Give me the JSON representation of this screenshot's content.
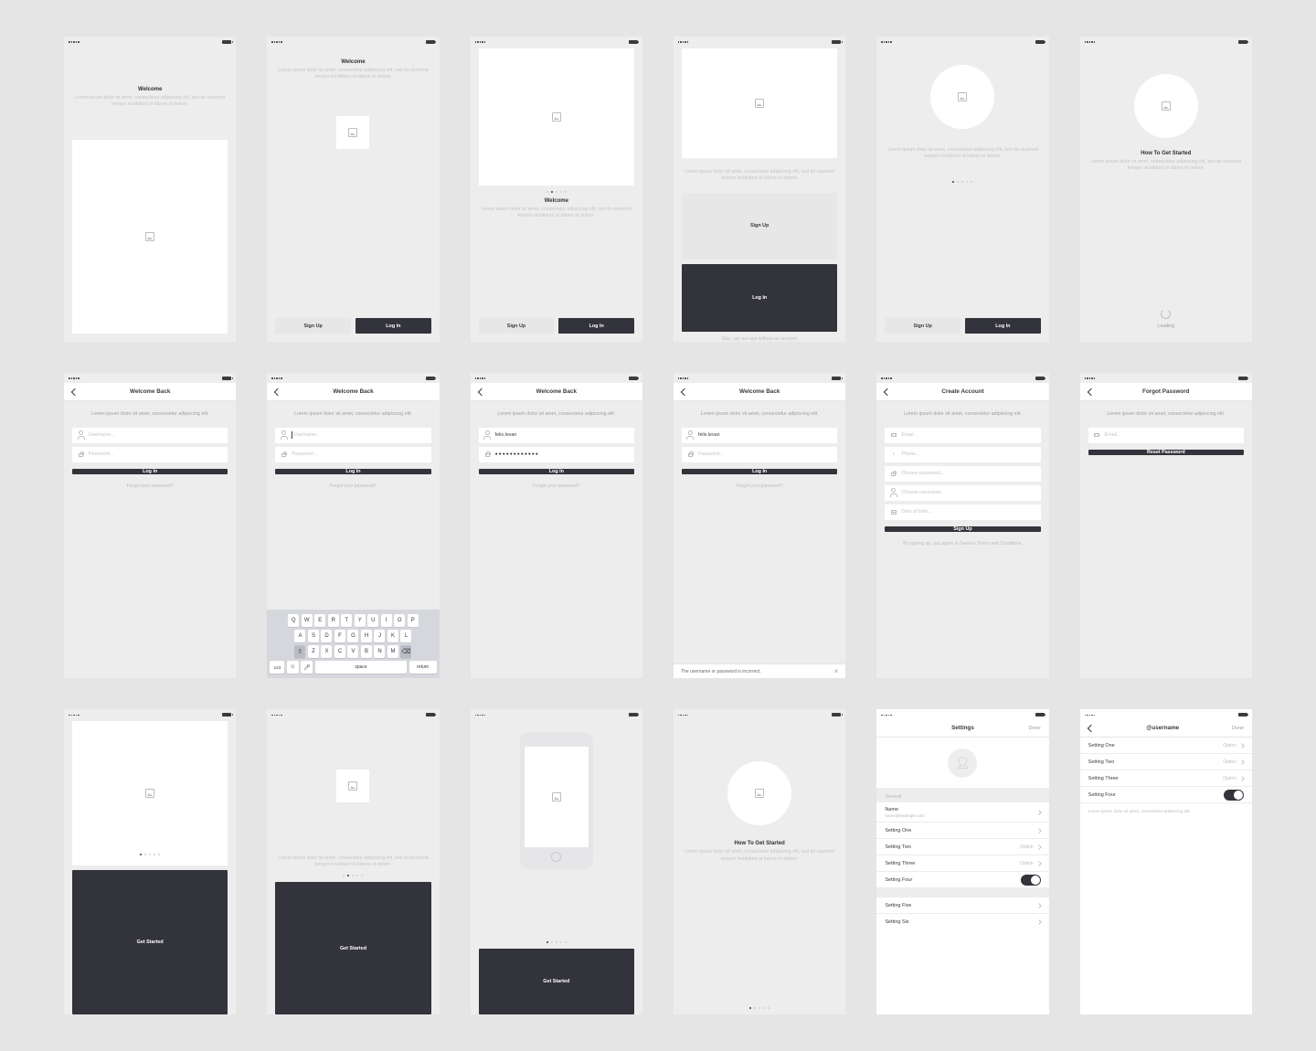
{
  "common": {
    "welcome": "Welcome",
    "lorem3": "Lorem ipsum dolor sit amet, consectetur adipiscing elit, sed do eiusmod tempor incididunt ut labore et dolore.",
    "lorem2": "Lorem ipsum dolor sit amet, consectetur adipiscing elit.",
    "signup": "Sign Up",
    "login": "Log In",
    "skip": "Skip, use our app without an account.",
    "howto": "How To Get Started",
    "loading": "Loading",
    "getstarted": "Get Started",
    "done": "Done"
  },
  "login": {
    "title": "Welcome Back",
    "username_ph": "Username...",
    "password_ph": "Password...",
    "username_val": "felix.levan",
    "pw_masked": "●●●●●●●●●●●●",
    "forgot": "Forgot your password?",
    "error": "The username or password is incorrect."
  },
  "create": {
    "title": "Create Account",
    "email_ph": "Email...",
    "phone_ph": "Phone...",
    "pw_ph": "Choose password...",
    "user_ph": "Choose username...",
    "dob_ph": "Date of birth...",
    "terms": "By signing up, you agree to Sense's Terms and Conditions."
  },
  "forgot": {
    "title": "Forgot Password",
    "email_ph": "Email...",
    "btn": "Reset Password"
  },
  "settings": {
    "title": "Settings",
    "user_title": "@username",
    "general": "General",
    "name": "Name",
    "name_sub": "name@example.com",
    "s1": "Setting One",
    "s2": "Setting Two",
    "s3": "Setting Three",
    "s4": "Setting Four",
    "s5": "Setting Five",
    "s6": "Setting Six",
    "option": "Option",
    "note": "Lorem ipsum dolor sit amet, consectetur adipiscing elit."
  },
  "kbd": {
    "r1": [
      "Q",
      "W",
      "E",
      "R",
      "T",
      "Y",
      "U",
      "I",
      "O",
      "P"
    ],
    "r2": [
      "A",
      "S",
      "D",
      "F",
      "G",
      "H",
      "J",
      "K",
      "L"
    ],
    "r3": [
      "Z",
      "X",
      "C",
      "V",
      "B",
      "N",
      "M"
    ],
    "num": "123",
    "space": "space",
    "return": "return"
  }
}
